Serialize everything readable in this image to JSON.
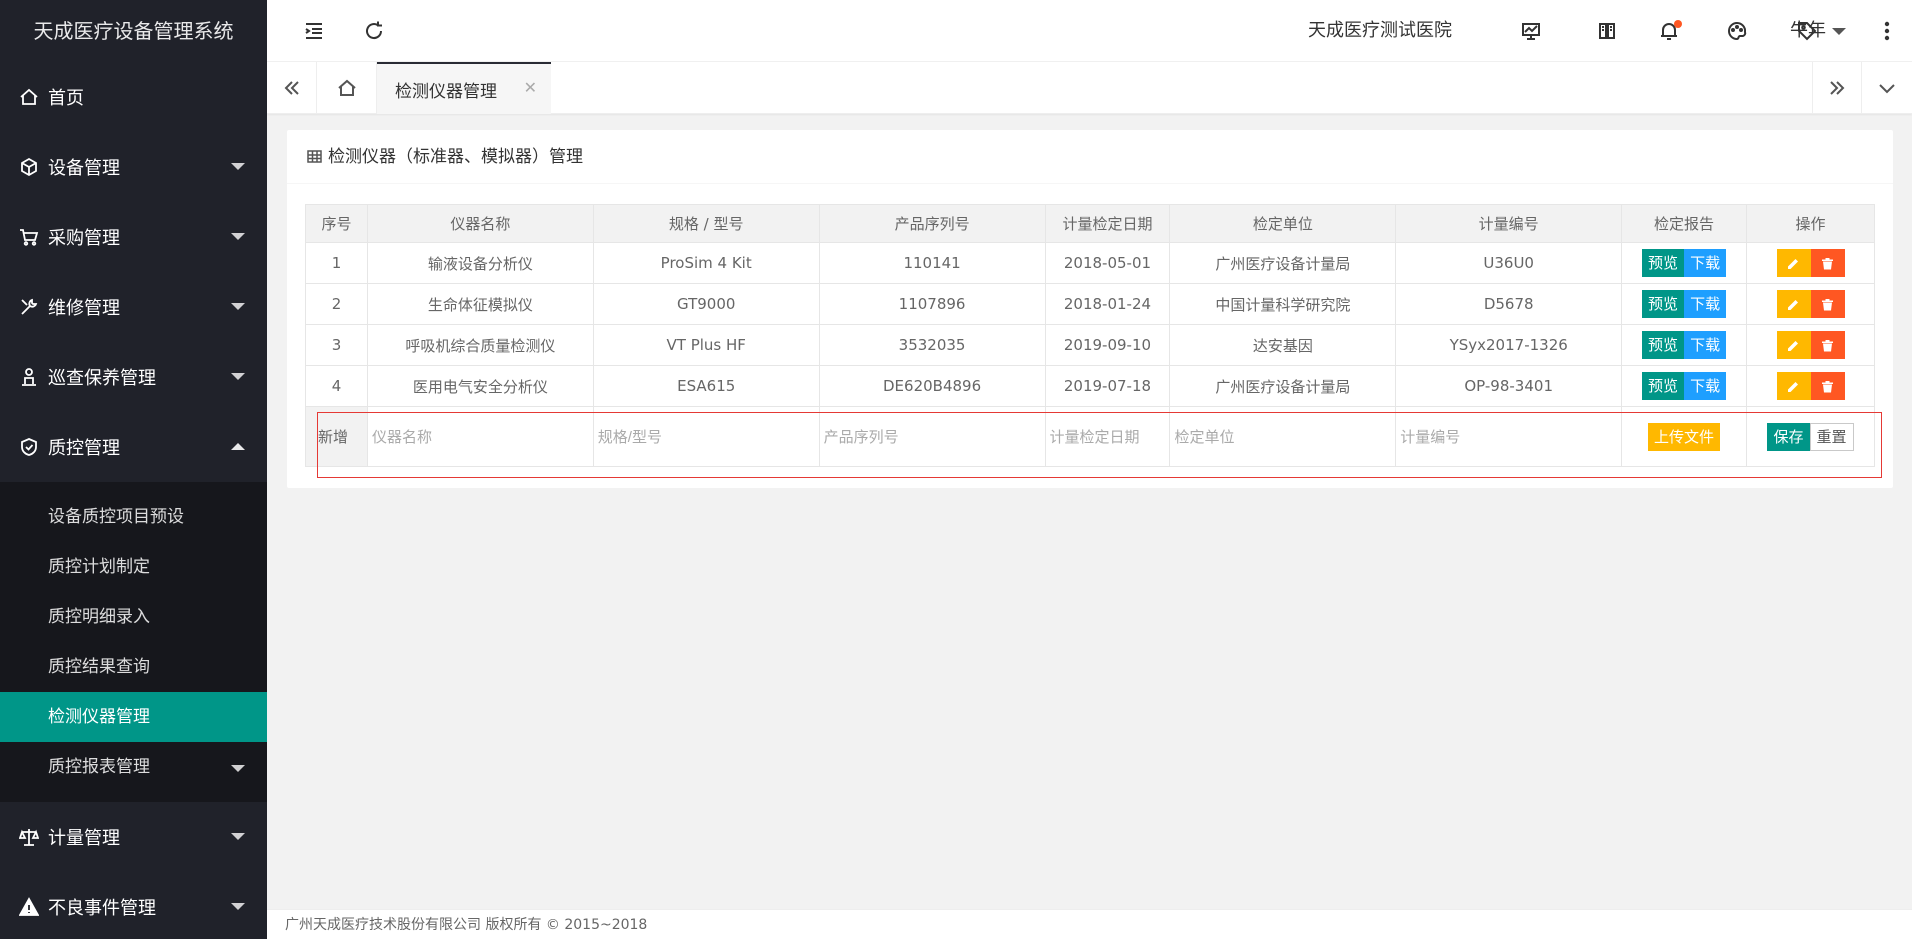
{
  "app": {
    "title": "天成医疗设备管理系统"
  },
  "sidebar": {
    "items": [
      {
        "label": "首页",
        "icon": "home-icon"
      },
      {
        "label": "设备管理",
        "icon": "cube-icon"
      },
      {
        "label": "采购管理",
        "icon": "cart-icon"
      },
      {
        "label": "维修管理",
        "icon": "wrench-icon"
      },
      {
        "label": "巡查保养管理",
        "icon": "person-icon"
      },
      {
        "label": "质控管理",
        "icon": "shield-icon"
      },
      {
        "label": "计量管理",
        "icon": "scale-icon"
      },
      {
        "label": "不良事件管理",
        "icon": "warning-icon"
      }
    ],
    "sub_items": [
      "设备质控项目预设",
      "质控计划制定",
      "质控明细录入",
      "质控结果查询",
      "检测仪器管理",
      "质控报表管理"
    ],
    "active_sub": "检测仪器管理"
  },
  "header": {
    "hospital": "天成医疗测试医院",
    "user": "牛年"
  },
  "tabs": {
    "active_label": "检测仪器管理",
    "close_symbol": "✕"
  },
  "card": {
    "title": "检测仪器（标准器、模拟器）管理"
  },
  "table": {
    "headers": [
      "序号",
      "仪器名称",
      "规格 / 型号",
      "产品序列号",
      "计量检定日期",
      "检定单位",
      "计量编号",
      "检定报告",
      "操作"
    ],
    "rows": [
      [
        "1",
        "输液设备分析仪",
        "ProSim 4 Kit",
        "110141",
        "2018-05-01",
        "广州医疗设备计量局",
        "U36U0"
      ],
      [
        "2",
        "生命体征模拟仪",
        "GT9000",
        "1107896",
        "2018-01-24",
        "中国计量科学研究院",
        "D5678"
      ],
      [
        "3",
        "呼吸机综合质量检测仪",
        "VT Plus HF",
        "3532035",
        "2019-09-10",
        "达安基因",
        "YSyx2017-1326"
      ],
      [
        "4",
        "医用电气安全分析仪",
        "ESA615",
        "DE620B4896",
        "2019-07-18",
        "广州医疗设备计量局",
        "OP-98-3401"
      ]
    ],
    "preview_label": "预览",
    "download_label": "下载"
  },
  "add_row": {
    "label": "新增",
    "placeholders": {
      "name": "仪器名称",
      "model": "规格/型号",
      "serial": "产品序列号",
      "date": "计量检定日期",
      "unit": "检定单位",
      "code": "计量编号"
    },
    "upload_label": "上传文件",
    "save_label": "保存",
    "reset_label": "重置"
  },
  "footer": {
    "text": "广州天成医疗技术股份有限公司 版权所有 © 2015~2018"
  },
  "colors": {
    "sidebar_bg": "#20222a",
    "accent": "#009688",
    "blue": "#1e9fff",
    "yellow": "#ffb800",
    "red": "#ff5722"
  }
}
